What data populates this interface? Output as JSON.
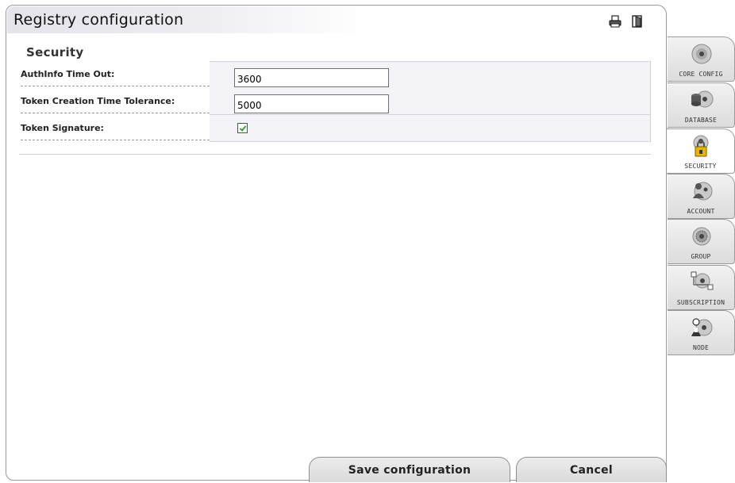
{
  "window": {
    "title": "Registry configuration"
  },
  "header_icons": [
    {
      "name": "print-icon"
    },
    {
      "name": "exit-icon"
    }
  ],
  "section": {
    "title": "Security"
  },
  "fields": [
    {
      "label": "AuthInfo Time Out:",
      "value": "3600"
    },
    {
      "label": "Token Creation Time Tolerance:",
      "value": "5000"
    },
    {
      "label": "Token Signature:",
      "checked": true
    }
  ],
  "buttons": {
    "save": "Save configuration",
    "cancel": "Cancel"
  },
  "tabs": [
    {
      "label": "CORE CONFIG",
      "icon": "core-config-icon",
      "active": false
    },
    {
      "label": "DATABASE",
      "icon": "database-icon",
      "active": false
    },
    {
      "label": "SECURITY",
      "icon": "security-lock-icon",
      "active": true
    },
    {
      "label": "ACCOUNT",
      "icon": "account-icon",
      "active": false
    },
    {
      "label": "GROUP",
      "icon": "group-icon",
      "active": false
    },
    {
      "label": "SUBSCRIPTION",
      "icon": "subscription-icon",
      "active": false
    },
    {
      "label": "NODE",
      "icon": "node-icon",
      "active": false
    }
  ],
  "colors": {
    "accent_check": "#2e9b2e",
    "tab_bg": "#e6e6e6"
  }
}
